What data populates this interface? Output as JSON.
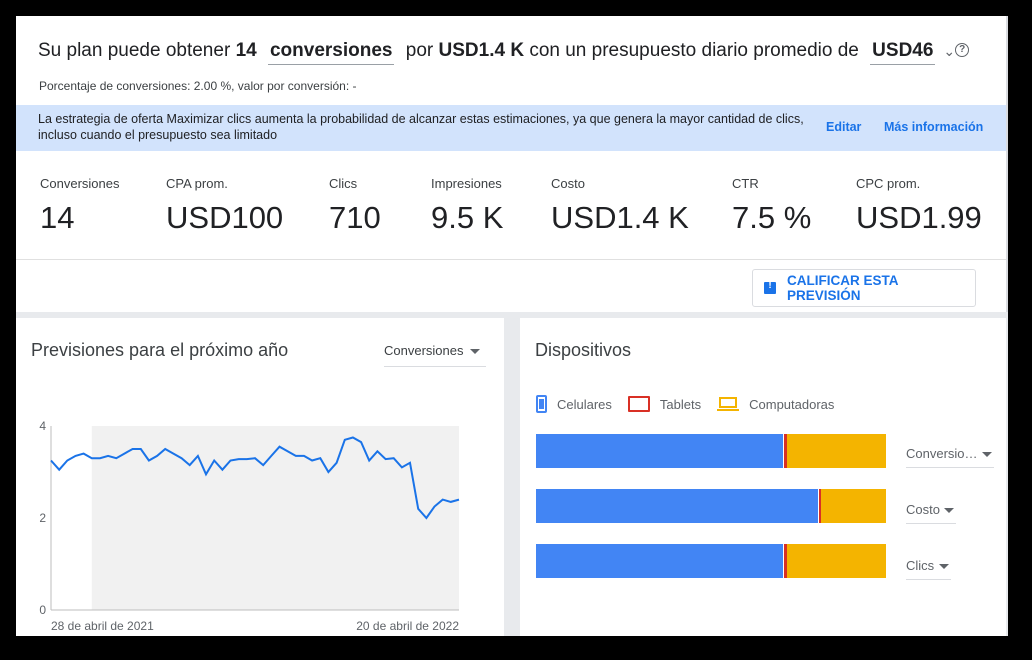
{
  "headline": {
    "prefix": "Su plan puede obtener",
    "count": "14",
    "metric": "conversiones",
    "mid": "por",
    "cost": "USD1.4 K",
    "suffix": "con un presupuesto diario promedio de",
    "budget": "USD46"
  },
  "subline": "Porcentaje de conversiones: 2.00 %, valor por conversión: -",
  "banner": {
    "text": "La estrategia de oferta Maximizar clics aumenta la probabilidad de alcanzar estas estimaciones, ya que genera la mayor cantidad de clics, incluso cuando el presupuesto sea limitado",
    "edit": "Editar",
    "more": "Más información"
  },
  "metrics": [
    {
      "label": "Conversiones",
      "value": "14"
    },
    {
      "label": "CPA prom.",
      "value": "USD100"
    },
    {
      "label": "Clics",
      "value": "710"
    },
    {
      "label": "Impresiones",
      "value": "9.5 K"
    },
    {
      "label": "Costo",
      "value": "USD1.4 K"
    },
    {
      "label": "CTR",
      "value": "7.5 %"
    },
    {
      "label": "CPC prom.",
      "value": "USD1.99"
    }
  ],
  "rate_button": "CALIFICAR ESTA PREVISIÓN",
  "forecast": {
    "title": "Previsiones para el próximo año",
    "selector": "Conversiones"
  },
  "devices": {
    "title": "Dispositivos",
    "legend": [
      {
        "name": "Celulares",
        "icon": "phone-icon",
        "color": "#4285f4"
      },
      {
        "name": "Tablets",
        "icon": "tablet-icon",
        "color": "#d93025"
      },
      {
        "name": "Computadoras",
        "icon": "laptop-icon",
        "color": "#f4b400"
      }
    ],
    "rows": [
      {
        "selector": "Conversio…",
        "shares": [
          0.705,
          0.012,
          0.283
        ]
      },
      {
        "selector": "Costo",
        "shares": [
          0.805,
          0.008,
          0.187
        ]
      },
      {
        "selector": "Clics",
        "shares": [
          0.705,
          0.012,
          0.283
        ]
      }
    ]
  },
  "chart_data": {
    "type": "line",
    "x_start_label": "28 de abril de 2021",
    "x_end_label": "20 de abril de 2022",
    "y_ticks": [
      "0",
      "2",
      "4"
    ],
    "ylim": [
      0,
      4
    ],
    "shaded_from_index": 5,
    "values": [
      3.25,
      3.05,
      3.25,
      3.35,
      3.4,
      3.3,
      3.3,
      3.35,
      3.3,
      3.4,
      3.5,
      3.5,
      3.25,
      3.35,
      3.5,
      3.4,
      3.3,
      3.15,
      3.35,
      2.95,
      3.25,
      3.05,
      3.25,
      3.28,
      3.28,
      3.3,
      3.15,
      3.35,
      3.55,
      3.45,
      3.35,
      3.35,
      3.25,
      3.3,
      3.0,
      3.2,
      3.7,
      3.75,
      3.65,
      3.25,
      3.45,
      3.28,
      3.3,
      3.1,
      3.2,
      2.2,
      2.0,
      2.25,
      2.4,
      2.35,
      2.4
    ],
    "color": "#1a73e8"
  }
}
